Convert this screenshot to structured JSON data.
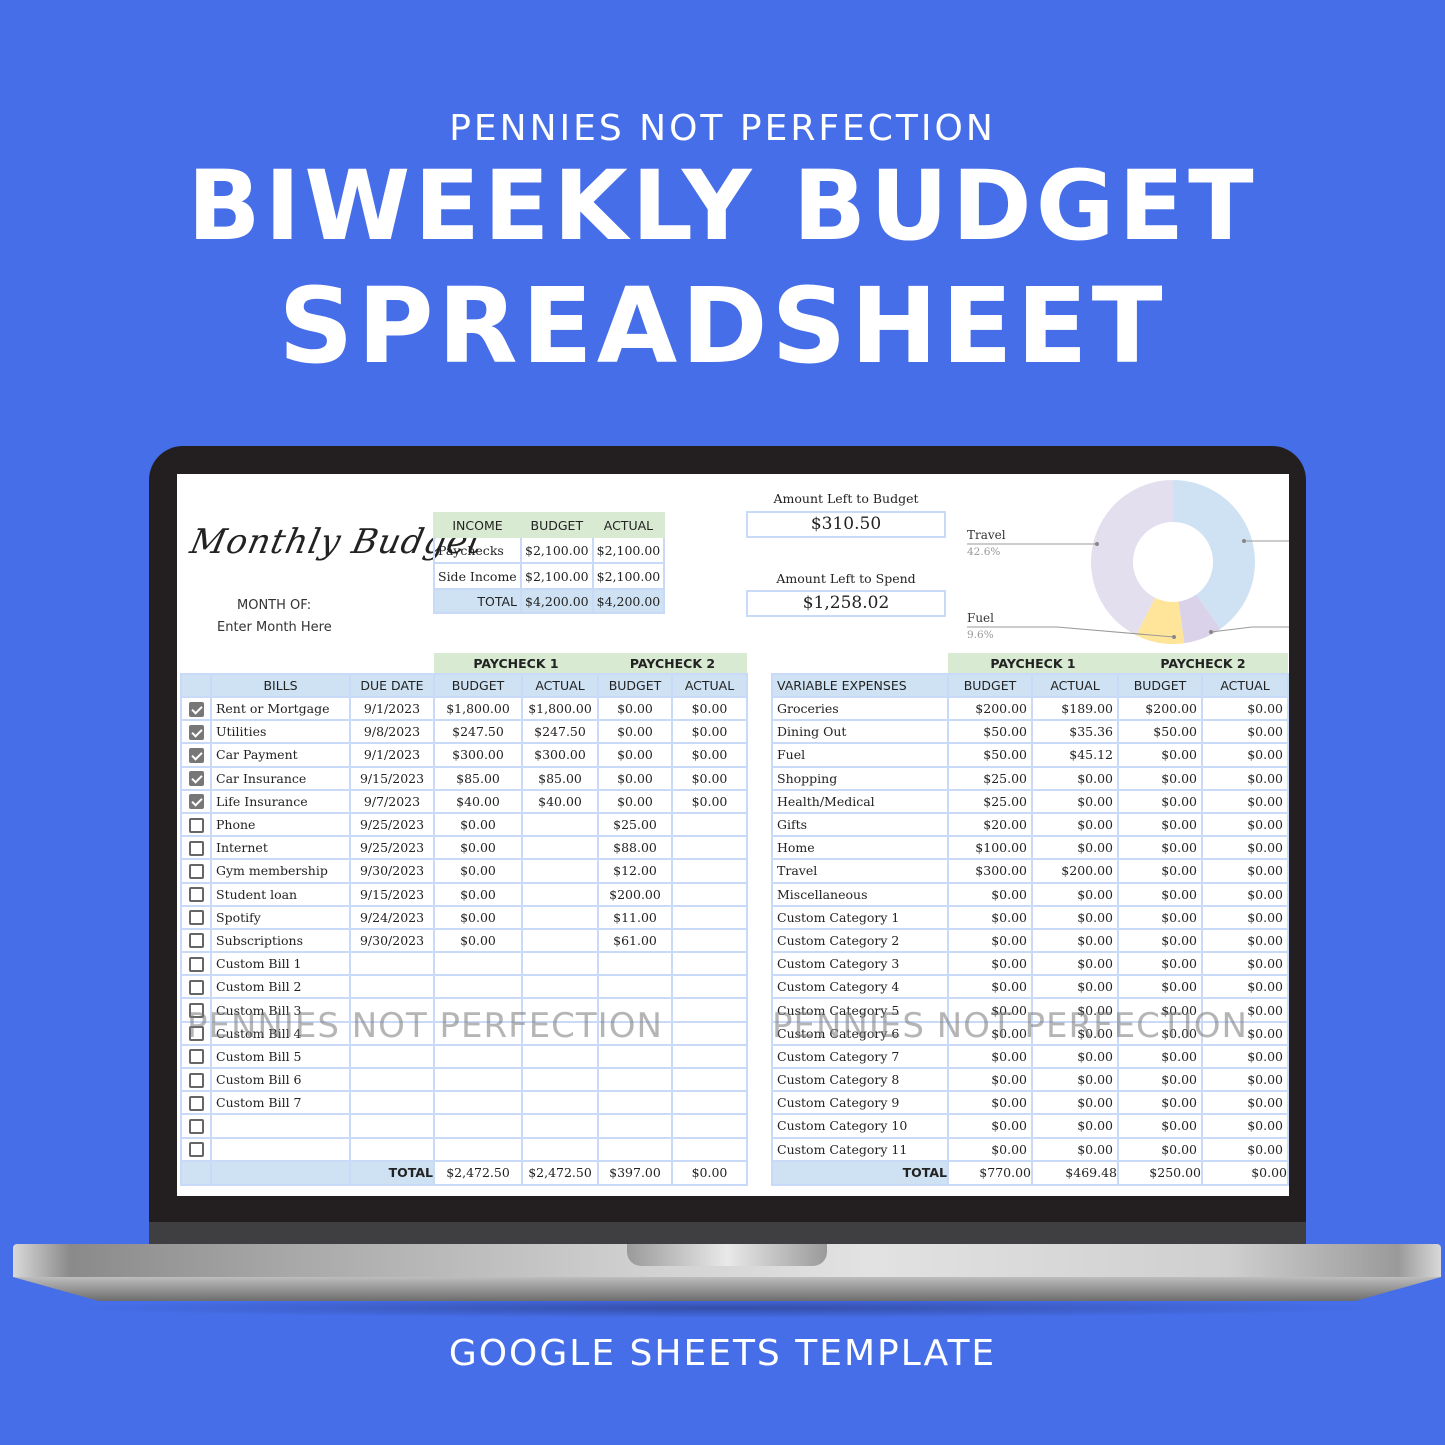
{
  "promo": {
    "brand": "PENNIES NOT PERFECTION",
    "title_line1": "BIWEEKLY BUDGET",
    "title_line2": "SPREADSHEET",
    "footer": "GOOGLE SHEETS TEMPLATE",
    "background_color": "#466ee8"
  },
  "sheet": {
    "script_title": "Monthly Budget",
    "month_of_label": "MONTH OF:",
    "month_value": "Enter Month Here",
    "watermark": "PENNIES NOT PERFECTION",
    "income": {
      "headers": [
        "INCOME",
        "BUDGET",
        "ACTUAL"
      ],
      "rows": [
        {
          "label": "Paychecks",
          "budget": "$2,100.00",
          "actual": "$2,100.00"
        },
        {
          "label": "Side Income",
          "budget": "$2,100.00",
          "actual": "$2,100.00"
        }
      ],
      "total": {
        "label": "TOTAL",
        "budget": "$4,200.00",
        "actual": "$4,200.00"
      }
    },
    "left_to_budget": {
      "label": "Amount Left to Budget",
      "value": "$310.50"
    },
    "left_to_spend": {
      "label": "Amount Left to Spend",
      "value": "$1,258.02"
    },
    "bills": {
      "paycheck_headers": [
        "PAYCHECK 1",
        "PAYCHECK 2"
      ],
      "headers": [
        "BILLS",
        "DUE DATE",
        "BUDGET",
        "ACTUAL",
        "BUDGET",
        "ACTUAL"
      ],
      "rows": [
        {
          "checked": true,
          "name": "Rent or Mortgage",
          "due": "9/1/2023",
          "p1_budget": "$1,800.00",
          "p1_actual": "$1,800.00",
          "p2_budget": "$0.00",
          "p2_actual": "$0.00"
        },
        {
          "checked": true,
          "name": "Utilities",
          "due": "9/8/2023",
          "p1_budget": "$247.50",
          "p1_actual": "$247.50",
          "p2_budget": "$0.00",
          "p2_actual": "$0.00"
        },
        {
          "checked": true,
          "name": "Car Payment",
          "due": "9/1/2023",
          "p1_budget": "$300.00",
          "p1_actual": "$300.00",
          "p2_budget": "$0.00",
          "p2_actual": "$0.00"
        },
        {
          "checked": true,
          "name": "Car Insurance",
          "due": "9/15/2023",
          "p1_budget": "$85.00",
          "p1_actual": "$85.00",
          "p2_budget": "$0.00",
          "p2_actual": "$0.00"
        },
        {
          "checked": true,
          "name": "Life Insurance",
          "due": "9/7/2023",
          "p1_budget": "$40.00",
          "p1_actual": "$40.00",
          "p2_budget": "$0.00",
          "p2_actual": "$0.00"
        },
        {
          "checked": false,
          "name": "Phone",
          "due": "9/25/2023",
          "p1_budget": "$0.00",
          "p1_actual": "",
          "p2_budget": "$25.00",
          "p2_actual": ""
        },
        {
          "checked": false,
          "name": "Internet",
          "due": "9/25/2023",
          "p1_budget": "$0.00",
          "p1_actual": "",
          "p2_budget": "$88.00",
          "p2_actual": ""
        },
        {
          "checked": false,
          "name": "Gym membership",
          "due": "9/30/2023",
          "p1_budget": "$0.00",
          "p1_actual": "",
          "p2_budget": "$12.00",
          "p2_actual": ""
        },
        {
          "checked": false,
          "name": "Student loan",
          "due": "9/15/2023",
          "p1_budget": "$0.00",
          "p1_actual": "",
          "p2_budget": "$200.00",
          "p2_actual": ""
        },
        {
          "checked": false,
          "name": "Spotify",
          "due": "9/24/2023",
          "p1_budget": "$0.00",
          "p1_actual": "",
          "p2_budget": "$11.00",
          "p2_actual": ""
        },
        {
          "checked": false,
          "name": "Subscriptions",
          "due": "9/30/2023",
          "p1_budget": "$0.00",
          "p1_actual": "",
          "p2_budget": "$61.00",
          "p2_actual": ""
        },
        {
          "checked": false,
          "name": "Custom Bill 1",
          "due": "",
          "p1_budget": "",
          "p1_actual": "",
          "p2_budget": "",
          "p2_actual": ""
        },
        {
          "checked": false,
          "name": "Custom Bill 2",
          "due": "",
          "p1_budget": "",
          "p1_actual": "",
          "p2_budget": "",
          "p2_actual": ""
        },
        {
          "checked": false,
          "name": "Custom Bill 3",
          "due": "",
          "p1_budget": "",
          "p1_actual": "",
          "p2_budget": "",
          "p2_actual": ""
        },
        {
          "checked": false,
          "name": "Custom Bill 4",
          "due": "",
          "p1_budget": "",
          "p1_actual": "",
          "p2_budget": "",
          "p2_actual": ""
        },
        {
          "checked": false,
          "name": "Custom Bill 5",
          "due": "",
          "p1_budget": "",
          "p1_actual": "",
          "p2_budget": "",
          "p2_actual": ""
        },
        {
          "checked": false,
          "name": "Custom Bill 6",
          "due": "",
          "p1_budget": "",
          "p1_actual": "",
          "p2_budget": "",
          "p2_actual": ""
        },
        {
          "checked": false,
          "name": "Custom Bill 7",
          "due": "",
          "p1_budget": "",
          "p1_actual": "",
          "p2_budget": "",
          "p2_actual": ""
        },
        {
          "checked": false,
          "name": "",
          "due": "",
          "p1_budget": "",
          "p1_actual": "",
          "p2_budget": "",
          "p2_actual": ""
        },
        {
          "checked": false,
          "name": "",
          "due": "",
          "p1_budget": "",
          "p1_actual": "",
          "p2_budget": "",
          "p2_actual": ""
        }
      ],
      "total": {
        "label": "TOTAL",
        "p1_budget": "$2,472.50",
        "p1_actual": "$2,472.50",
        "p2_budget": "$397.00",
        "p2_actual": "$0.00"
      }
    },
    "variable": {
      "paycheck_headers": [
        "PAYCHECK 1",
        "PAYCHECK 2"
      ],
      "headers": [
        "VARIABLE EXPENSES",
        "BUDGET",
        "ACTUAL",
        "BUDGET",
        "ACTUAL"
      ],
      "rows": [
        {
          "name": "Groceries",
          "p1_budget": "$200.00",
          "p1_actual": "$189.00",
          "p2_budget": "$200.00",
          "p2_actual": "$0.00"
        },
        {
          "name": "Dining Out",
          "p1_budget": "$50.00",
          "p1_actual": "$35.36",
          "p2_budget": "$50.00",
          "p2_actual": "$0.00"
        },
        {
          "name": "Fuel",
          "p1_budget": "$50.00",
          "p1_actual": "$45.12",
          "p2_budget": "$0.00",
          "p2_actual": "$0.00"
        },
        {
          "name": "Shopping",
          "p1_budget": "$25.00",
          "p1_actual": "$0.00",
          "p2_budget": "$0.00",
          "p2_actual": "$0.00"
        },
        {
          "name": "Health/Medical",
          "p1_budget": "$25.00",
          "p1_actual": "$0.00",
          "p2_budget": "$0.00",
          "p2_actual": "$0.00"
        },
        {
          "name": "Gifts",
          "p1_budget": "$20.00",
          "p1_actual": "$0.00",
          "p2_budget": "$0.00",
          "p2_actual": "$0.00"
        },
        {
          "name": "Home",
          "p1_budget": "$100.00",
          "p1_actual": "$0.00",
          "p2_budget": "$0.00",
          "p2_actual": "$0.00"
        },
        {
          "name": "Travel",
          "p1_budget": "$300.00",
          "p1_actual": "$200.00",
          "p2_budget": "$0.00",
          "p2_actual": "$0.00"
        },
        {
          "name": "Miscellaneous",
          "p1_budget": "$0.00",
          "p1_actual": "$0.00",
          "p2_budget": "$0.00",
          "p2_actual": "$0.00"
        },
        {
          "name": "Custom Category 1",
          "p1_budget": "$0.00",
          "p1_actual": "$0.00",
          "p2_budget": "$0.00",
          "p2_actual": "$0.00"
        },
        {
          "name": "Custom Category 2",
          "p1_budget": "$0.00",
          "p1_actual": "$0.00",
          "p2_budget": "$0.00",
          "p2_actual": "$0.00"
        },
        {
          "name": "Custom Category 3",
          "p1_budget": "$0.00",
          "p1_actual": "$0.00",
          "p2_budget": "$0.00",
          "p2_actual": "$0.00"
        },
        {
          "name": "Custom Category 4",
          "p1_budget": "$0.00",
          "p1_actual": "$0.00",
          "p2_budget": "$0.00",
          "p2_actual": "$0.00"
        },
        {
          "name": "Custom Category 5",
          "p1_budget": "$0.00",
          "p1_actual": "$0.00",
          "p2_budget": "$0.00",
          "p2_actual": "$0.00"
        },
        {
          "name": "Custom Category 6",
          "p1_budget": "$0.00",
          "p1_actual": "$0.00",
          "p2_budget": "$0.00",
          "p2_actual": "$0.00"
        },
        {
          "name": "Custom Category 7",
          "p1_budget": "$0.00",
          "p1_actual": "$0.00",
          "p2_budget": "$0.00",
          "p2_actual": "$0.00"
        },
        {
          "name": "Custom Category 8",
          "p1_budget": "$0.00",
          "p1_actual": "$0.00",
          "p2_budget": "$0.00",
          "p2_actual": "$0.00"
        },
        {
          "name": "Custom Category 9",
          "p1_budget": "$0.00",
          "p1_actual": "$0.00",
          "p2_budget": "$0.00",
          "p2_actual": "$0.00"
        },
        {
          "name": "Custom Category 10",
          "p1_budget": "$0.00",
          "p1_actual": "$0.00",
          "p2_budget": "$0.00",
          "p2_actual": "$0.00"
        },
        {
          "name": "Custom Category 11",
          "p1_budget": "$0.00",
          "p1_actual": "$0.00",
          "p2_budget": "$0.00",
          "p2_actual": "$0.00"
        }
      ],
      "total": {
        "label": "TOTAL",
        "p1_budget": "$770.00",
        "p1_actual": "$469.48",
        "p2_budget": "$250.00",
        "p2_actual": "$0.00"
      }
    },
    "donut": {
      "slices": [
        {
          "label": "",
          "percent": 40.2,
          "color": "#cfe2f3"
        },
        {
          "label": "",
          "percent": 7.6,
          "color": "#d9d2e9"
        },
        {
          "label": "Fuel",
          "percent": 9.6,
          "color": "#ffe599"
        },
        {
          "label": "Travel",
          "percent": 42.6,
          "color": "#e4dfef"
        }
      ],
      "visible_labels": [
        {
          "label": "Travel",
          "value": "42.6%"
        },
        {
          "label": "Fuel",
          "value": "9.6%"
        }
      ]
    }
  }
}
